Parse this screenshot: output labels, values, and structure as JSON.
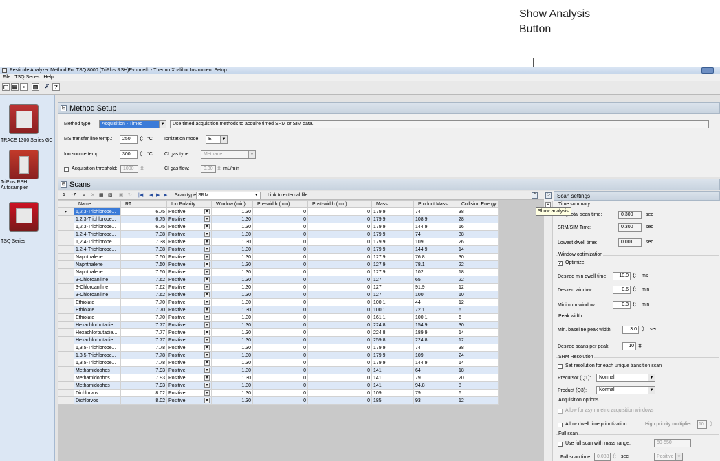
{
  "callout": {
    "line1": "Show Analysis",
    "line2": "Button"
  },
  "window": {
    "title": "Pesticide Analyzer Method For TSQ 8000 (TriPlus RSH)Evo.meth - Thermo Xcalibur Instrument Setup"
  },
  "menu": {
    "items": [
      "File",
      "TSQ Series",
      "Help"
    ]
  },
  "toolbar_icons": [
    "new-icon",
    "open-icon",
    "save-icon",
    "print-icon",
    "cut-icon",
    "help-icon"
  ],
  "devices": [
    {
      "label": "TRACE 1300 Series GC"
    },
    {
      "label": "TriPlus RSH Autosampler"
    },
    {
      "label": "TSQ Series"
    }
  ],
  "method_setup": {
    "title": "Method Setup",
    "method_type_label": "Method type:",
    "method_type_value": "Acquisition - Timed",
    "method_type_hint": "Use timed acquisition methods to acquire timed SRM or SIM data.",
    "ms_transfer_label": "MS transfer line temp.:",
    "ms_transfer_value": "250",
    "ms_transfer_unit": "°C",
    "ionization_label": "Ionization mode:",
    "ionization_value": "EI",
    "ion_source_label": "Ion source temp.:",
    "ion_source_value": "300",
    "ion_source_unit": "°C",
    "ci_gas_type_label": "CI gas type:",
    "ci_gas_type_value": "Methane",
    "acq_threshold_label": "Acquisition threshold:",
    "acq_threshold_value": "1000",
    "ci_gas_flow_label": "CI gas flow:",
    "ci_gas_flow_value": "0.30",
    "ci_gas_flow_unit": "mL/min"
  },
  "scans": {
    "title": "Scans",
    "scan_type_label": "Scan type",
    "scan_type_value": "SRM",
    "link_label": "Link to external file",
    "columns": [
      "Name",
      "RT",
      "Ion Polarity",
      "Window (min)",
      "Pre-width (min)",
      "Post-width (min)",
      "Mass",
      "Product Mass",
      "Collision Energy"
    ],
    "rows": [
      [
        "1,2,3-Trichlorobe...",
        "6.75",
        "Positive",
        "1.30",
        "0",
        "0",
        "179.9",
        "74",
        "38"
      ],
      [
        "1,2,3-Trichlorobe...",
        "6.75",
        "Positive",
        "1.30",
        "0",
        "0",
        "179.9",
        "108.9",
        "28"
      ],
      [
        "1,2,3-Trichlorobe...",
        "6.75",
        "Positive",
        "1.30",
        "0",
        "0",
        "179.9",
        "144.9",
        "16"
      ],
      [
        "1,2,4-Trichlorobe...",
        "7.38",
        "Positive",
        "1.30",
        "0",
        "0",
        "179.9",
        "74",
        "38"
      ],
      [
        "1,2,4-Trichlorobe...",
        "7.38",
        "Positive",
        "1.30",
        "0",
        "0",
        "179.9",
        "109",
        "26"
      ],
      [
        "1,2,4-Trichlorobe...",
        "7.38",
        "Positive",
        "1.30",
        "0",
        "0",
        "179.9",
        "144.9",
        "14"
      ],
      [
        "Naphthalene",
        "7.50",
        "Positive",
        "1.30",
        "0",
        "0",
        "127.9",
        "76.8",
        "30"
      ],
      [
        "Naphthalene",
        "7.50",
        "Positive",
        "1.30",
        "0",
        "0",
        "127.9",
        "78.1",
        "22"
      ],
      [
        "Naphthalene",
        "7.50",
        "Positive",
        "1.30",
        "0",
        "0",
        "127.9",
        "102",
        "18"
      ],
      [
        "3-Chloroaniline",
        "7.62",
        "Positive",
        "1.30",
        "0",
        "0",
        "127",
        "65",
        "22"
      ],
      [
        "3-Chloroaniline",
        "7.62",
        "Positive",
        "1.30",
        "0",
        "0",
        "127",
        "91.9",
        "12"
      ],
      [
        "3-Chloroaniline",
        "7.62",
        "Positive",
        "1.30",
        "0",
        "0",
        "127",
        "100",
        "10"
      ],
      [
        "Ethiolate",
        "7.70",
        "Positive",
        "1.30",
        "0",
        "0",
        "100.1",
        "44",
        "12"
      ],
      [
        "Ethiolate",
        "7.70",
        "Positive",
        "1.30",
        "0",
        "0",
        "100.1",
        "72.1",
        "6"
      ],
      [
        "Ethiolate",
        "7.70",
        "Positive",
        "1.30",
        "0",
        "0",
        "161.1",
        "100.1",
        "6"
      ],
      [
        "Hexachlorbutadie...",
        "7.77",
        "Positive",
        "1.30",
        "0",
        "0",
        "224.8",
        "154.9",
        "30"
      ],
      [
        "Hexachlorbutadie...",
        "7.77",
        "Positive",
        "1.30",
        "0",
        "0",
        "224.8",
        "189.9",
        "14"
      ],
      [
        "Hexachlorbutadie...",
        "7.77",
        "Positive",
        "1.30",
        "0",
        "0",
        "259.8",
        "224.8",
        "12"
      ],
      [
        "1,3,5-Trichlorobe...",
        "7.78",
        "Positive",
        "1.30",
        "0",
        "0",
        "179.9",
        "74",
        "38"
      ],
      [
        "1,3,5-Trichlorobe...",
        "7.78",
        "Positive",
        "1.30",
        "0",
        "0",
        "179.9",
        "109",
        "24"
      ],
      [
        "1,3,5-Trichlorobe...",
        "7.78",
        "Positive",
        "1.30",
        "0",
        "0",
        "179.9",
        "144.9",
        "14"
      ],
      [
        "Methamidophos",
        "7.93",
        "Positive",
        "1.30",
        "0",
        "0",
        "141",
        "64",
        "18"
      ],
      [
        "Methamidophos",
        "7.93",
        "Positive",
        "1.30",
        "0",
        "0",
        "141",
        "79",
        "20"
      ],
      [
        "Methamidophos",
        "7.93",
        "Positive",
        "1.30",
        "0",
        "0",
        "141",
        "94.8",
        "8"
      ],
      [
        "Dichlorvos",
        "8.02",
        "Positive",
        "1.30",
        "0",
        "0",
        "109",
        "79",
        "6"
      ],
      [
        "Dichlorvos",
        "8.02",
        "Positive",
        "1.30",
        "0",
        "0",
        "185",
        "93",
        "12"
      ]
    ]
  },
  "scan_settings": {
    "title": "Scan settings",
    "tooltip": "Show analysis",
    "time_summary": {
      "title": "Time summary",
      "total_label": "ting total scan time:",
      "total_value": "0.300",
      "total_unit": "sec",
      "srm_label": "SRM/SIM Time:",
      "srm_value": "0.300",
      "srm_unit": "sec",
      "lowest_label": "Lowest dwell time:",
      "lowest_value": "0.001",
      "lowest_unit": "sec"
    },
    "window_opt": {
      "title": "Window optimization",
      "optimize_label": "Optimize",
      "min_dwell_label": "Desired min dwell time:",
      "min_dwell_value": "10.0",
      "min_dwell_unit": "ms",
      "desired_window_label": "Desired window",
      "desired_window_value": "0.6",
      "desired_window_unit": "min",
      "min_window_label": "Minimum window",
      "min_window_value": "0.3",
      "min_window_unit": "min"
    },
    "peak_width": {
      "title": "Peak width",
      "baseline_label": "Min. baseline peak width:",
      "baseline_value": "3.0",
      "baseline_unit": "sec",
      "scans_label": "Desired scans per peak:",
      "scans_value": "10"
    },
    "srm_res": {
      "title": "SRM Resolution",
      "set_res_label": "Set resolution for each unique transition scan",
      "precursor_label": "Precursor (Q1):",
      "precursor_value": "Normal",
      "product_label": "Product (Q3):",
      "product_value": "Normal"
    },
    "acq_options": {
      "title": "Acquisition options",
      "asym_label": "Allow for asymmetric acquisition windows",
      "dwell_label": "Allow dwell time prioritization",
      "hp_label": "High priority multiplier:",
      "hp_value": "10"
    },
    "full_scan": {
      "title": "Full scan",
      "use_label": "Use full scan with mass range:",
      "range_value": "50-550",
      "time_label": "Full scan time:",
      "time_value": "0.083",
      "time_unit": "sec",
      "polarity_value": "Positive"
    }
  }
}
